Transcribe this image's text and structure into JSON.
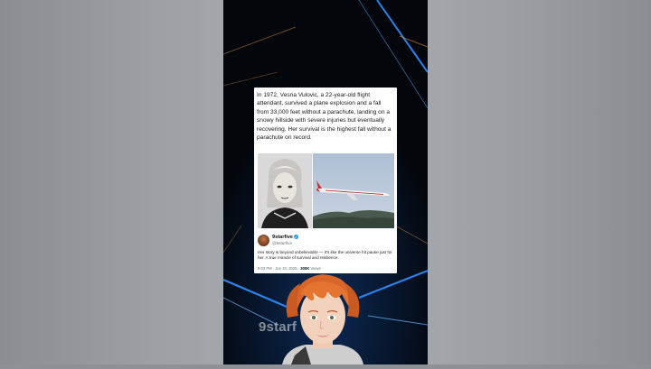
{
  "post": {
    "text": "In 1972, Vesna Vulovic, a 22-year-old flight attendant, survived a plane explosion and a fall from 33,000 feet without a parachute, landing on a snowy hillside with severe injuries but eventually recovering. Her survival is the highest fall without a parachute on record."
  },
  "tweet": {
    "name": "9starfive",
    "handle": "@9starfive",
    "body": "Her story is beyond unbelievable — it's like the universe hit pause just for her. A true miracle of survival and resilience.",
    "time": "9:03 PM · Jun 10, 2025 ·",
    "views_count": "300K",
    "views_label": "Views"
  },
  "watermark": "9starf",
  "colors": {
    "verified": "#1d9bf0",
    "beam": "#2f8cff",
    "background_side": "#9a9ea3",
    "hair": "#d8662a"
  },
  "icons": [
    "verified-badge-icon"
  ]
}
